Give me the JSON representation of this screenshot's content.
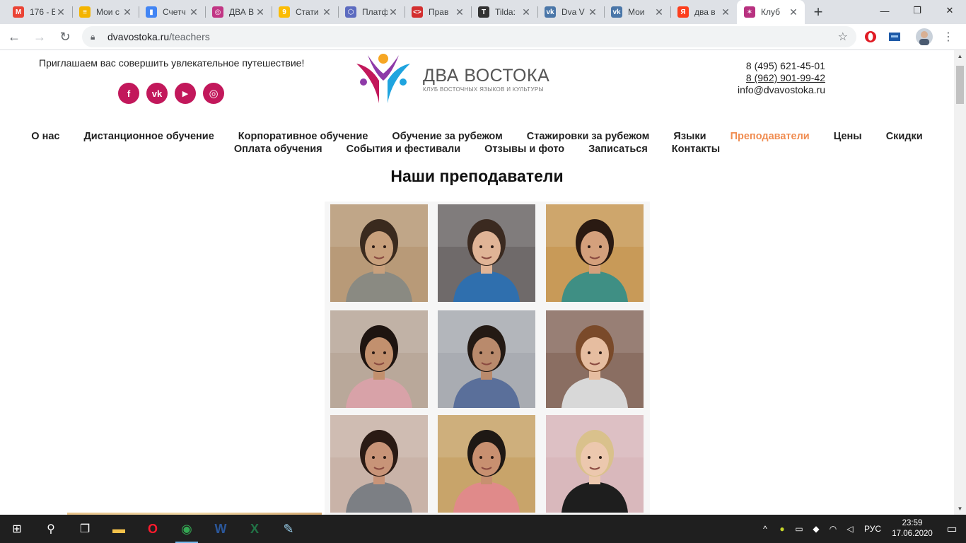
{
  "browser": {
    "tabs": [
      {
        "title": "176 - E",
        "icon": "gmail-icon",
        "color": "#ea4335",
        "glyph": "M"
      },
      {
        "title": "Мои с",
        "icon": "notes-icon",
        "color": "#f4b400",
        "glyph": "≡"
      },
      {
        "title": "Счетч",
        "icon": "metrics-icon",
        "color": "#4285f4",
        "glyph": "▮"
      },
      {
        "title": "ДВА В",
        "icon": "instagram-icon",
        "color": "#c13584",
        "glyph": "◎"
      },
      {
        "title": "Стати",
        "icon": "stats-icon",
        "color": "#fbbc04",
        "glyph": "9"
      },
      {
        "title": "Платф",
        "icon": "cube-icon",
        "color": "#5c6bc0",
        "glyph": "⬡"
      },
      {
        "title": "Прав",
        "icon": "code-icon",
        "color": "#d32f2f",
        "glyph": "<>"
      },
      {
        "title": "Tilda:",
        "icon": "tilda-icon",
        "color": "#333333",
        "glyph": "T"
      },
      {
        "title": "Dva V",
        "icon": "vk-icon",
        "color": "#4a76a8",
        "glyph": "vk"
      },
      {
        "title": "Мои",
        "icon": "vk-icon",
        "color": "#4a76a8",
        "glyph": "vk"
      },
      {
        "title": "два в",
        "icon": "yandex-icon",
        "color": "#fc3f1d",
        "glyph": "Я"
      },
      {
        "title": "Клуб",
        "icon": "club-logo-icon",
        "color": "#b83280",
        "glyph": "✶",
        "active": true
      }
    ],
    "url_host": "dvavostoka.ru",
    "url_path": "/teachers"
  },
  "header": {
    "tagline": "Приглашаем вас совершить увлекательное путешествие!",
    "socials": [
      {
        "name": "facebook",
        "glyph": "f"
      },
      {
        "name": "vk",
        "glyph": "vk"
      },
      {
        "name": "youtube",
        "glyph": "▶"
      },
      {
        "name": "instagram",
        "glyph": "◎"
      }
    ],
    "brand_name": "ДВА ВОСТОКА",
    "brand_sub": "КЛУБ ВОСТОЧНЫХ ЯЗЫКОВ И КУЛЬТУРЫ",
    "phone1": "8 (495) 621-45-01",
    "phone2": "8 (962) 901-99-42",
    "email": "info@dvavostoka.ru"
  },
  "menu": {
    "row1": [
      "О нас",
      "Дистанционное обучение",
      "Корпоративное обучение",
      "Обучение за рубежом",
      "Стажировки за рубежом",
      "Языки",
      "Преподаватели",
      "Цены",
      "Скидки"
    ],
    "row2": [
      "Оплата обучения",
      "События и фестивали",
      "Отзывы и фото",
      "Записаться",
      "Контакты"
    ],
    "active": "Преподаватели",
    "active_color": "#f08c50"
  },
  "page_title": "Наши преподаватели",
  "teachers": [
    {
      "bg": "#b89a78",
      "skin": "#c8a07c",
      "hair": "#3a2a1e",
      "shirt": "#8a8a82"
    },
    {
      "bg": "#6f6a6a",
      "skin": "#e0b496",
      "hair": "#3b2a20",
      "shirt": "#2f6fae"
    },
    {
      "bg": "#c89a58",
      "skin": "#d4a07c",
      "hair": "#2a1a12",
      "shirt": "#3f8f84"
    },
    {
      "bg": "#b9a89a",
      "skin": "#c2906e",
      "hair": "#1e1410",
      "shirt": "#d8a2a8"
    },
    {
      "bg": "#a9acb2",
      "skin": "#b98a6c",
      "hair": "#241a14",
      "shirt": "#5a6f9a"
    },
    {
      "bg": "#8a6e62",
      "skin": "#e6bda0",
      "hair": "#7a4a2a",
      "shirt": "#d8d8d8"
    },
    {
      "bg": "#c9b3a8",
      "skin": "#c89478",
      "hair": "#2a1a14",
      "shirt": "#7c7f84"
    },
    {
      "bg": "#c8a46a",
      "skin": "#c89070",
      "hair": "#1e1814",
      "shirt": "#e08a8a"
    },
    {
      "bg": "#d9b8bc",
      "skin": "#ecc8ae",
      "hair": "#d9c18c",
      "shirt": "#1e1e1e"
    }
  ],
  "taskbar": {
    "apps": [
      {
        "name": "start",
        "glyph": "⊞"
      },
      {
        "name": "search",
        "glyph": "⚲"
      },
      {
        "name": "task-view",
        "glyph": "❐"
      },
      {
        "name": "explorer",
        "glyph": "▬",
        "color": "#f3c14a"
      },
      {
        "name": "opera",
        "glyph": "O",
        "color": "#ff1b2d"
      },
      {
        "name": "chrome",
        "glyph": "◉",
        "color": "#34a853",
        "open": true
      },
      {
        "name": "word",
        "glyph": "W",
        "color": "#2b579a"
      },
      {
        "name": "excel",
        "glyph": "X",
        "color": "#217346"
      },
      {
        "name": "paint",
        "glyph": "✎",
        "color": "#9ad0ec"
      }
    ],
    "language": "РУС",
    "time": "23:59",
    "date": "17.06.2020"
  }
}
